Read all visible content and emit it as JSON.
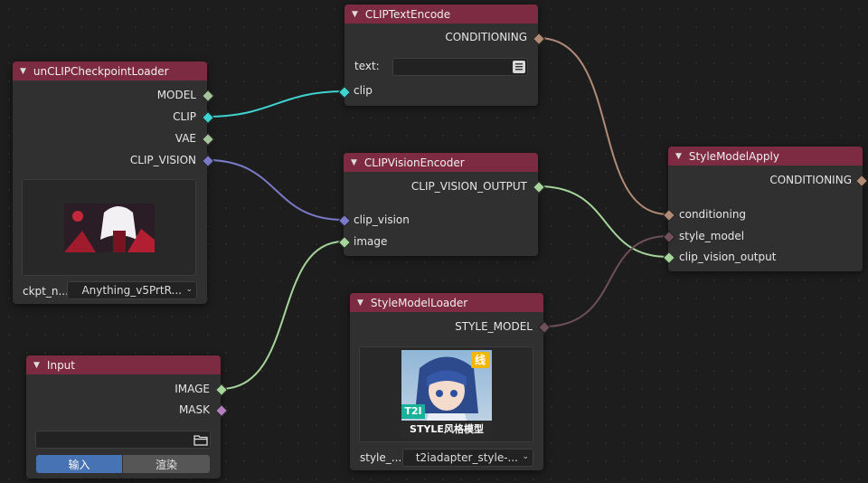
{
  "colors": {
    "header": "#7d2a43",
    "clip": "#3fd3cf",
    "clip_vision": "#7a7ac8",
    "image": "#a6d49a",
    "conditioning": "#b28b76",
    "style_model": "#6e4f5a",
    "mask": "#b47fbf",
    "button_active": "#4772b3"
  },
  "nodes": {
    "clip_text_encode": {
      "title": "CLIPTextEncode",
      "output": "CONDITIONING",
      "text_label": "text:",
      "text_value": "",
      "input": "clip"
    },
    "checkpoint_loader": {
      "title": "unCLIPCheckpointLoader",
      "outputs": [
        "MODEL",
        "CLIP",
        "VAE",
        "CLIP_VISION"
      ],
      "ckpt_label": "ckpt_n...",
      "ckpt_value": "Anything_v5PrtR..."
    },
    "clip_vision_encoder": {
      "title": "CLIPVisionEncoder",
      "output": "CLIP_VISION_OUTPUT",
      "inputs": [
        "clip_vision",
        "image"
      ]
    },
    "style_model_apply": {
      "title": "StyleModelApply",
      "output": "CONDITIONING",
      "inputs": [
        "conditioning",
        "style_model",
        "clip_vision_output"
      ]
    },
    "style_model_loader": {
      "title": "StyleModelLoader",
      "output": "STYLE_MODEL",
      "preview_badge": "线",
      "preview_tag": "T2I",
      "preview_caption": "STYLE风格模型",
      "style_label": "style_...",
      "style_value": "t2iadapter_style-..."
    },
    "input": {
      "title": "Input",
      "outputs": [
        "IMAGE",
        "MASK"
      ],
      "path_value": "",
      "buttons": [
        "输入",
        "渲染"
      ]
    }
  }
}
